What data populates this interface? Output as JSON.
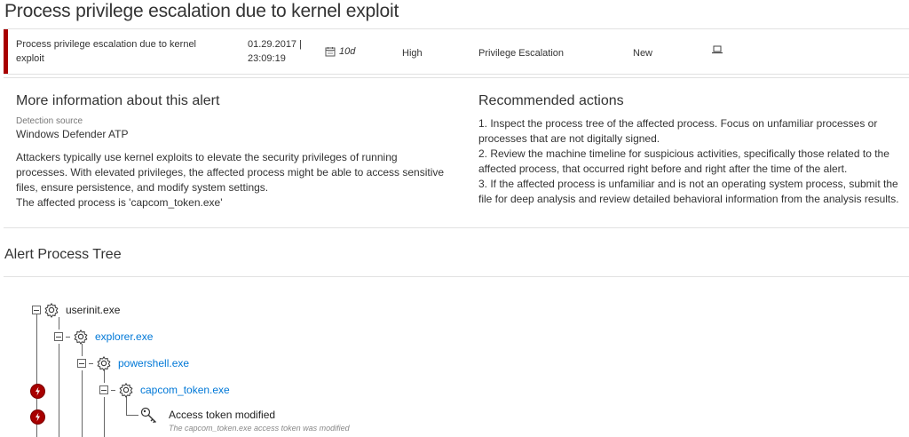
{
  "page": {
    "title": "Process privilege escalation due to kernel exploit"
  },
  "alert": {
    "title": "Process privilege escalation due to kernel exploit",
    "datetime_line1": "01.29.2017 |",
    "datetime_line2": "23:09:19",
    "age": "10d",
    "severity": "High",
    "category": "Privilege Escalation",
    "status": "New",
    "severity_color": "#a80000",
    "icons": {
      "age": "calendar-icon",
      "machine": "laptop-icon"
    }
  },
  "info": {
    "heading": "More information about this alert",
    "detection_label": "Detection source",
    "detection_value": "Windows Defender ATP",
    "description": "Attackers typically use kernel exploits to elevate the security privileges of running processes. With elevated privileges, the affected process might be able to access sensitive files, ensure persistence, and modify system settings.",
    "affected": "The affected process is 'capcom_token.exe'"
  },
  "actions": {
    "heading": "Recommended actions",
    "items": [
      "1. Inspect the process tree of the affected process. Focus on unfamiliar processes or processes that are not digitally signed.",
      "2. Review the machine timeline for suspicious activities, specifically those related to the affected process, that occurred right before and right after the time of the alert.",
      "3. If the affected process is unfamiliar and is not an operating system process, submit the file for deep analysis and review detailed behavioral information from the analysis results."
    ]
  },
  "tree": {
    "heading": "Alert Process Tree",
    "link_color": "#0078d7",
    "nodes": [
      {
        "name": "userinit.exe"
      },
      {
        "name": "explorer.exe"
      },
      {
        "name": "powershell.exe"
      },
      {
        "name": "capcom_token.exe"
      }
    ],
    "event": {
      "title": "Access token modified",
      "subtitle": "The capcom_token.exe access token was modified",
      "icon": "key-icon"
    }
  }
}
